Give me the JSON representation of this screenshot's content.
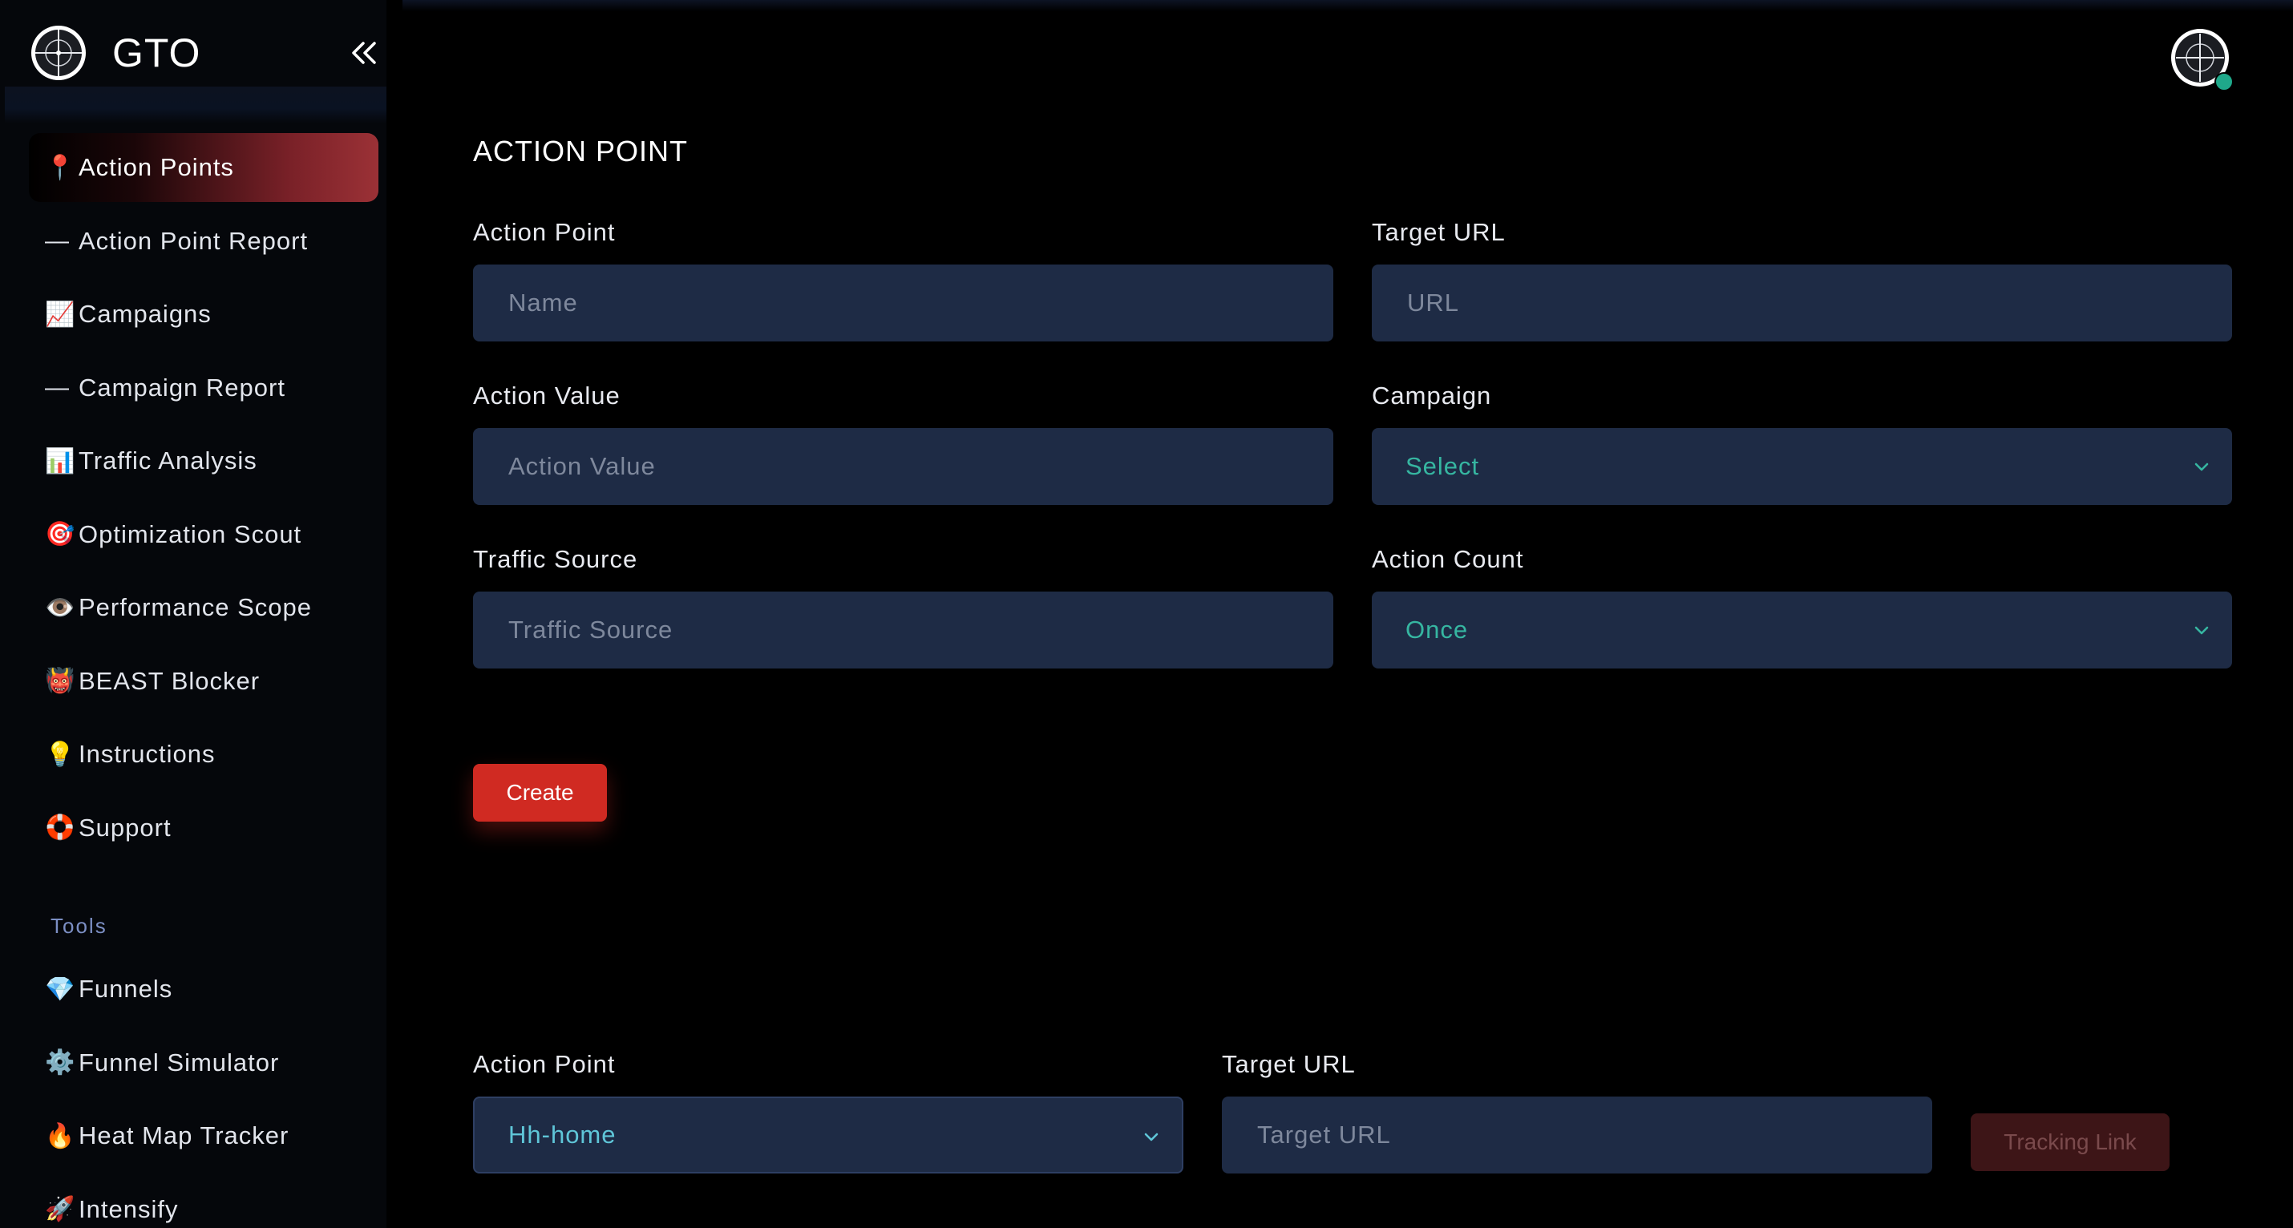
{
  "app": {
    "name": "GTO"
  },
  "sidebar": {
    "items": [
      {
        "icon": "📍",
        "label": "Action Points",
        "active": true
      },
      {
        "icon": "—",
        "label": "Action Point Report"
      },
      {
        "icon": "📈",
        "label": "Campaigns"
      },
      {
        "icon": "—",
        "label": "Campaign Report"
      },
      {
        "icon": "📊",
        "label": "Traffic Analysis"
      },
      {
        "icon": "🎯",
        "label": "Optimization Scout"
      },
      {
        "icon": "👁️",
        "label": "Performance Scope"
      },
      {
        "icon": "👹",
        "label": "BEAST Blocker"
      },
      {
        "icon": "💡",
        "label": "Instructions"
      },
      {
        "icon": "🛟",
        "label": "Support"
      }
    ],
    "tools_label": "Tools",
    "tools": [
      {
        "icon": "💎",
        "label": "Funnels"
      },
      {
        "icon": "⚙️",
        "label": "Funnel Simulator"
      },
      {
        "icon": "🔥",
        "label": "Heat Map Tracker"
      },
      {
        "icon": "🚀",
        "label": "Intensify"
      }
    ]
  },
  "form": {
    "title": "ACTION POINT",
    "action_point": {
      "label": "Action Point",
      "placeholder": "Name"
    },
    "target_url": {
      "label": "Target URL",
      "placeholder": "URL"
    },
    "action_value": {
      "label": "Action Value",
      "placeholder": "Action Value"
    },
    "campaign": {
      "label": "Campaign",
      "value": "Select"
    },
    "traffic_source": {
      "label": "Traffic Source",
      "placeholder": "Traffic Source"
    },
    "action_count": {
      "label": "Action Count",
      "value": "Once"
    },
    "create_label": "Create"
  },
  "tracking": {
    "action_point": {
      "label": "Action Point",
      "value": "Hh-home"
    },
    "target_url": {
      "label": "Target URL",
      "placeholder": "Target URL"
    },
    "button_label": "Tracking Link"
  },
  "colors": {
    "accent_red": "#d02a22",
    "field_bg": "#1e2b45",
    "select_text": "#36b6a1",
    "tools_label": "#7c8fc4"
  }
}
